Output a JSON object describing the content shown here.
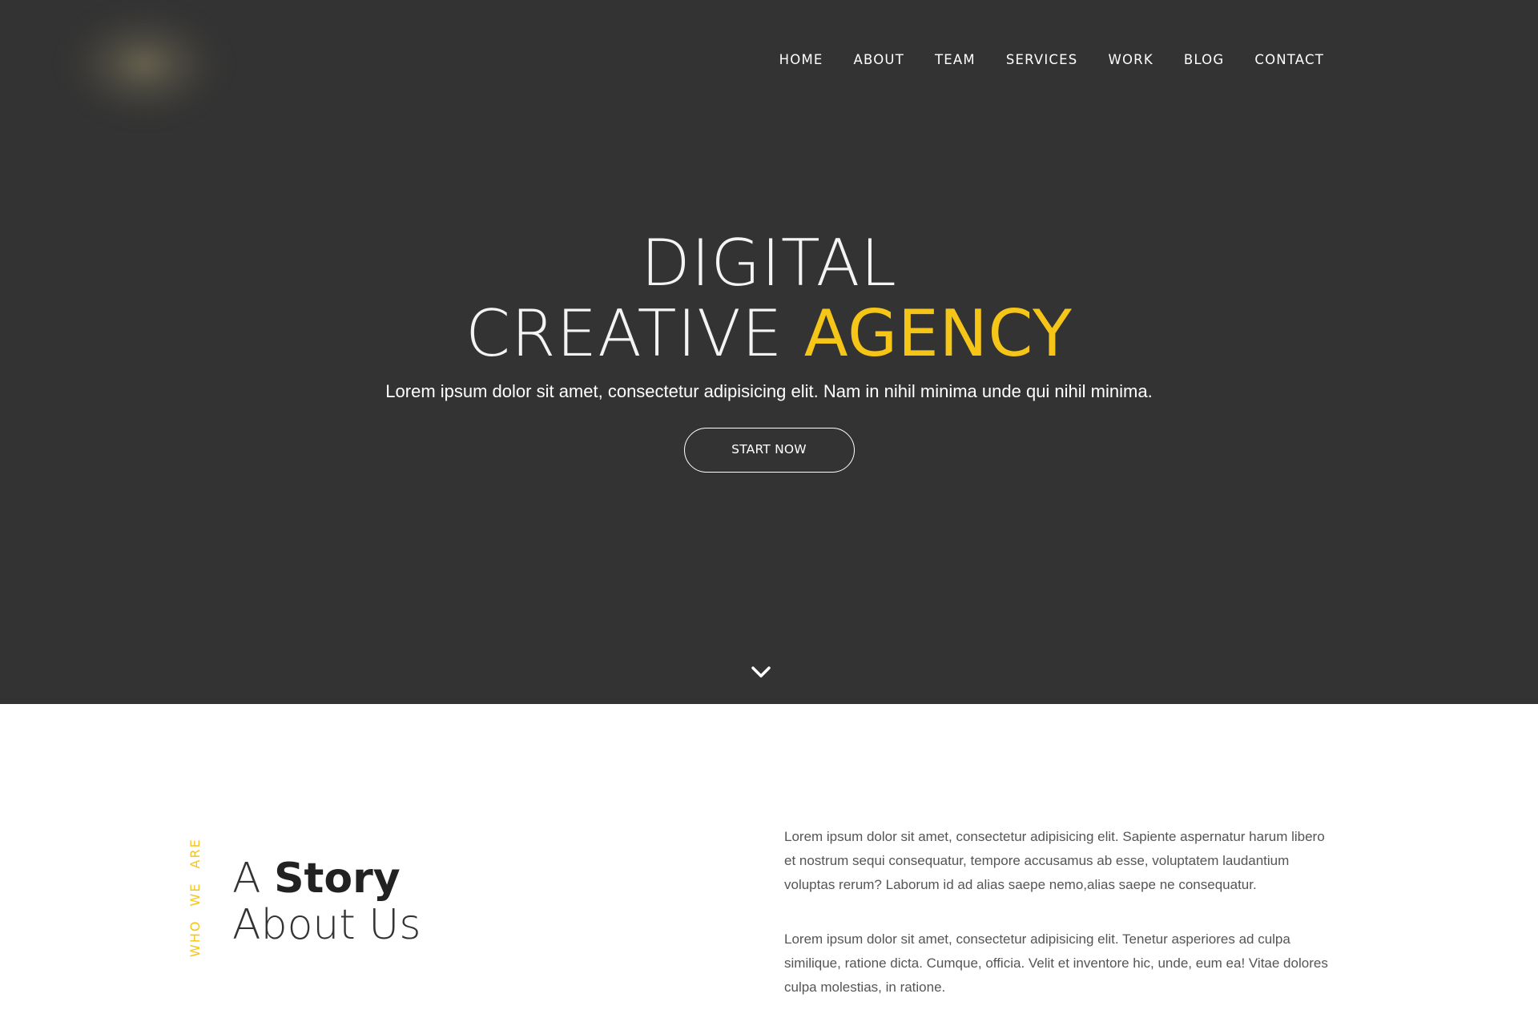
{
  "nav": {
    "items": [
      "HOME",
      "ABOUT",
      "TEAM",
      "SERVICES",
      "WORK",
      "BLOG",
      "CONTACT"
    ]
  },
  "hero": {
    "title_line1": "DIGITAL",
    "title_line2_thin": "CREATIVE",
    "title_line2_accent": "AGENCY",
    "subtitle": "Lorem ipsum dolor sit amet, consectetur adipisicing elit. Nam in nihil minima unde qui nihil minima.",
    "button_label": "START NOW",
    "scroll_icon": "chevron-down-icon"
  },
  "about": {
    "eyebrow": "WHO WE ARE",
    "heading_prefix": "A",
    "heading_bold": "Story",
    "heading_line2": "About Us",
    "paragraphs": [
      "Lorem ipsum dolor sit amet, consectetur adipisicing elit. Sapiente aspernatur harum libero et nostrum sequi consequatur, tempore accusamus ab esse, voluptatem laudantium voluptas rerum? Laborum id ad alias saepe nemo,alias saepe ne consequatur.",
      "Lorem ipsum dolor sit amet, consectetur adipisicing elit. Tenetur asperiores ad culpa similique, ratione dicta. Cumque, officia. Velit et inventore hic, unde, eum ea! Vitae dolores culpa molestias, in ratione."
    ]
  },
  "colors": {
    "hero_bg": "#333333",
    "accent": "#f5c518",
    "body_text": "#555555",
    "heading_text": "#333333"
  }
}
